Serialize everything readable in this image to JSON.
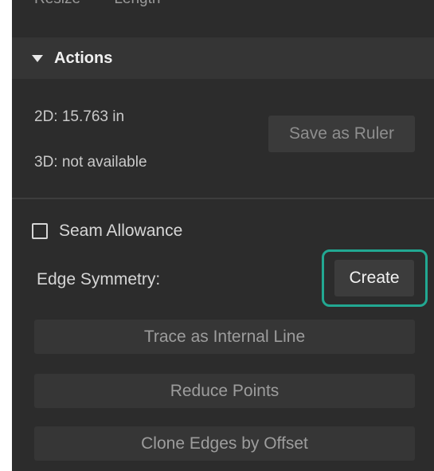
{
  "top_partial": {
    "left_text": "Resize",
    "right_text": "Length"
  },
  "actions": {
    "title": "Actions",
    "measure_2d": "2D: 15.763 in",
    "measure_3d": "3D: not available",
    "save_ruler_label": "Save as Ruler",
    "seam_allowance_label": "Seam Allowance",
    "seam_allowance_checked": false,
    "edge_symmetry_label": "Edge Symmetry:",
    "create_label": "Create",
    "trace_label": "Trace as Internal Line",
    "reduce_label": "Reduce Points",
    "clone_label": "Clone Edges by Offset"
  },
  "colors": {
    "panel_bg": "#2c2c2c",
    "header_bg": "#353535",
    "highlight": "#22a892"
  }
}
